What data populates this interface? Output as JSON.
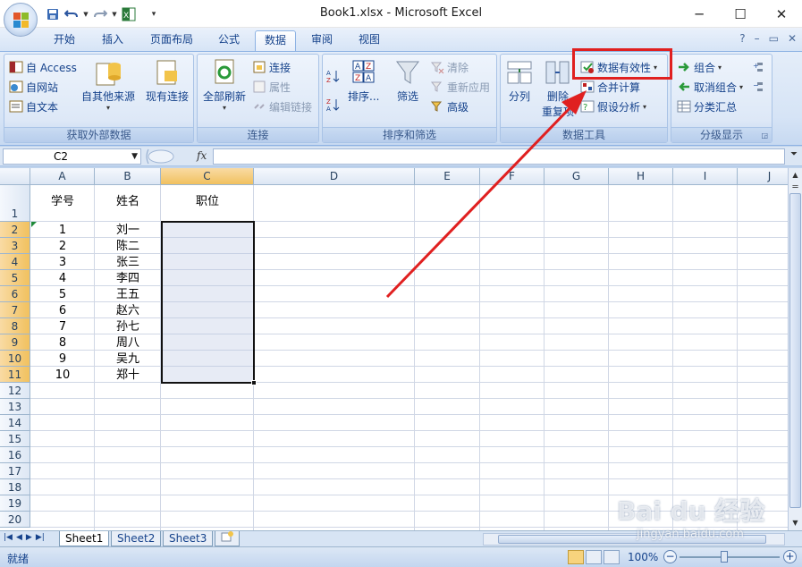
{
  "window": {
    "title": "Book1.xlsx - Microsoft Excel",
    "minimize": "─",
    "maximize": "☐",
    "close": "✕"
  },
  "ribbon_tabs": [
    "开始",
    "插入",
    "页面布局",
    "公式",
    "数据",
    "审阅",
    "视图"
  ],
  "active_tab": "数据",
  "ribbon_right_icons": [
    "?",
    "–",
    "▭",
    "✕"
  ],
  "groups": {
    "external": {
      "label": "获取外部数据",
      "access": "自 Access",
      "web": "自网站",
      "text": "自文本",
      "other_sources": "自其他来源",
      "existing": "现有连接"
    },
    "connections": {
      "label": "连接",
      "refresh_all": "全部刷新",
      "connections": "连接",
      "properties": "属性",
      "edit_links": "编辑链接"
    },
    "sort_filter": {
      "label": "排序和筛选",
      "sort": "排序...",
      "filter": "筛选",
      "clear": "清除",
      "reapply": "重新应用",
      "advanced": "高级"
    },
    "data_tools": {
      "label": "数据工具",
      "text_to_columns": "分列",
      "remove_duplicates": "删除\n重复项",
      "remove_label_top": "删除",
      "remove_label_bottom": "重复项",
      "data_validation": "数据有效性",
      "consolidate": "合并计算",
      "what_if": "假设分析"
    },
    "outline": {
      "label": "分级显示",
      "group": "组合",
      "ungroup": "取消组合",
      "subtotal": "分类汇总"
    }
  },
  "formula_bar": {
    "name_box": "C2",
    "fx": "fx",
    "formula": ""
  },
  "columns": [
    "A",
    "B",
    "C",
    "D",
    "E",
    "F",
    "G",
    "H",
    "I",
    "J"
  ],
  "rows": [
    "1",
    "2",
    "3",
    "4",
    "5",
    "6",
    "7",
    "8",
    "9",
    "10",
    "11",
    "12",
    "13",
    "14",
    "15",
    "16",
    "17",
    "18",
    "19",
    "20"
  ],
  "sheet": {
    "headers": [
      "学号",
      "姓名",
      "职位"
    ],
    "data": [
      [
        "1",
        "刘一"
      ],
      [
        "2",
        "陈二"
      ],
      [
        "3",
        "张三"
      ],
      [
        "4",
        "李四"
      ],
      [
        "5",
        "王五"
      ],
      [
        "6",
        "赵六"
      ],
      [
        "7",
        "孙七"
      ],
      [
        "8",
        "周八"
      ],
      [
        "9",
        "吴九"
      ],
      [
        "10",
        "郑十"
      ]
    ]
  },
  "sheet_tabs": [
    "Sheet1",
    "Sheet2",
    "Sheet3"
  ],
  "active_sheet": "Sheet1",
  "status": {
    "ready": "就绪",
    "zoom": "100%",
    "zoom_out": "−",
    "zoom_in": "+"
  },
  "watermark": {
    "main": "Bai du 经验",
    "sub": "jingyan.baidu.com"
  },
  "colors": {
    "annotation": "#e02020",
    "selection_border": "#111111",
    "header_selected": "#f1c15f"
  }
}
